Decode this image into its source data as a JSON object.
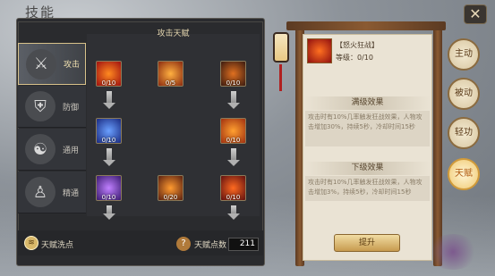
{
  "window": {
    "title": "技能",
    "close_glyph": "✕"
  },
  "categories": [
    {
      "label": "攻击",
      "icon": "sword-icon",
      "active": true
    },
    {
      "label": "防御",
      "icon": "shield-icon",
      "active": false
    },
    {
      "label": "通用",
      "icon": "yinyang-icon",
      "active": false
    },
    {
      "label": "精通",
      "icon": "person-icon",
      "active": false
    }
  ],
  "tree": {
    "title": "攻击天赋",
    "nodes": [
      {
        "count": "0/10"
      },
      {
        "count": "0/5"
      },
      {
        "count": "0/10"
      },
      {
        "count": "0/10"
      },
      {
        "count": "0/10"
      },
      {
        "count": "0/10"
      },
      {
        "count": "0/20"
      },
      {
        "count": "0/10"
      }
    ]
  },
  "bottom": {
    "wash_label": "天赋洗点",
    "points_label": "天赋点数",
    "points_value": "211",
    "help_glyph": "?"
  },
  "detail": {
    "skill_name": "【怒火狂战】",
    "level": "等级：0/10",
    "max_title": "满级效果",
    "max_desc": "攻击时有10%几率触发狂战效果，人物攻击增加30%，持续5秒，冷却时间15秒",
    "next_title": "下级效果",
    "next_desc": "攻击时有10%几率触发狂战效果，人物攻击增加3%，持续5秒，冷却时间15秒",
    "upgrade_label": "提升"
  },
  "side_tabs": [
    {
      "label": "主动",
      "active": false
    },
    {
      "label": "被动",
      "active": false
    },
    {
      "label": "轻功",
      "active": false
    },
    {
      "label": "天赋",
      "active": true
    }
  ]
}
